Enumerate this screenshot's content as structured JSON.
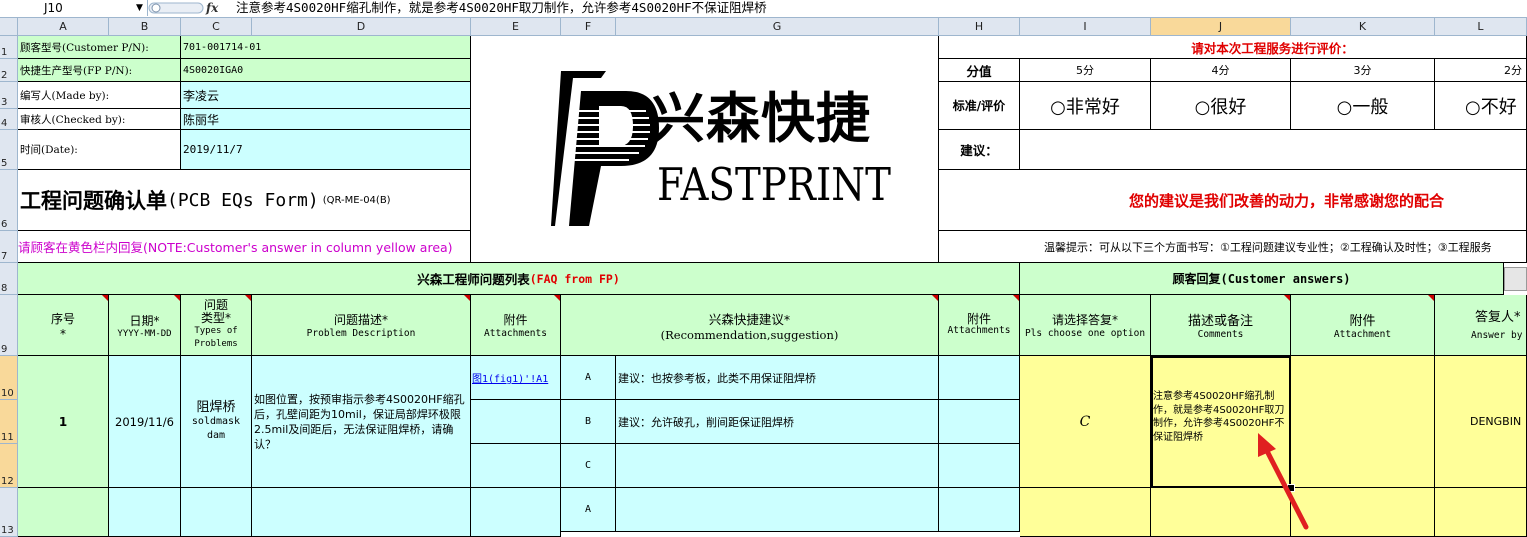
{
  "formula_bar": {
    "name_box": "J10",
    "fx": "fx",
    "content": "注意参考4S0020HF缩孔制作，就是参考4S0020HF取刀制作，允许参考4S0020HF不保证阻焊桥"
  },
  "columns": [
    "A",
    "B",
    "C",
    "D",
    "E",
    "F",
    "G",
    "H",
    "I",
    "J",
    "K",
    "L"
  ],
  "rows": [
    "1",
    "2",
    "3",
    "4",
    "5",
    "6",
    "7",
    "8",
    "9",
    "10",
    "11",
    "12",
    "13"
  ],
  "header_info": {
    "customer_pn_label": "顾客型号(Customer P/N):",
    "customer_pn": "701-001714-01",
    "fp_pn_label": "快捷生产型号(FP P/N):",
    "fp_pn": "4S0020IGA0",
    "made_by_label": "编写人(Made by):",
    "made_by": "李凌云",
    "checked_by_label": "审核人(Checked by):",
    "checked_by": "陈丽华",
    "date_label": "时间(Date):",
    "date": "2019/11/7",
    "form_title": "工程问题确认单",
    "form_title_en": "(PCB EQs Form)",
    "form_code": "(QR-ME-04(B)",
    "note": "请顾客在黄色栏内回复(NOTE:Customer's answer in column yellow area)"
  },
  "logo": {
    "cn": "兴森快捷",
    "en": "FASTPRINT"
  },
  "evaluation": {
    "title": "请对本次工程服务进行评价：",
    "score_label": "分值",
    "scores": [
      "5分",
      "4分",
      "3分",
      "2分"
    ],
    "criteria_label": "标准/评价",
    "options": [
      "○非常好",
      "○很好",
      "○一般",
      "○不好"
    ],
    "suggestion_label": "建议：",
    "thanks": "您的建议是我们改善的动力，非常感谢您的配合",
    "tip": "温馨提示：可从以下三个方面书写：①工程问题建议专业性；②工程确认及时性；③工程服务"
  },
  "sections": {
    "faq": "兴森工程师问题列表",
    "faq_en": "(FAQ from FP)",
    "customer": "顾客回复(Customer answers)"
  },
  "table_headers": {
    "no": "序号",
    "no_star": "*",
    "date": "日期*",
    "date_fmt": "YYYY-MM-DD",
    "type": "问题类型*",
    "type_en": "Types of Problems",
    "desc": "问题描述*",
    "desc_en": "Problem Description",
    "attach": "附件",
    "attach_en": "Attachments",
    "rec": "兴森快捷建议*",
    "rec_en": "(Recommendation,suggestion)",
    "attach2": "附件",
    "attach2_en": "Attachments",
    "choose": "请选择答复*",
    "choose_en": "Pls choose one option",
    "comments": "描述或备注",
    "comments_en": "Comments",
    "attach3": "附件",
    "attach3_en": "Attachment",
    "answer_by": "答复人*",
    "answer_by_en": "Answer by"
  },
  "item": {
    "no": "1",
    "date": "2019/11/6",
    "type": "阻焊桥",
    "type_en": "soldmask dam",
    "desc": "如图位置，按预审指示参考4S0020HF缩孔后，孔壁间距为10mil，保证局部焊环极限2.5mil及间距后，无法保证阻焊桥，请确认？",
    "attach_link": "图1(fig1)'!A1",
    "options": [
      "A",
      "B",
      "C"
    ],
    "option_texts": [
      "建议：也按参考板，此类不用保证阻焊桥",
      "建议：允许破孔，削间距保证阻焊桥",
      ""
    ],
    "choice": "C",
    "comment": "注意参考4S0020HF缩孔制作，就是参考4S0020HF取刀制作，允许参考4S0020HF不保证阻焊桥",
    "answer_by": "DENGBIN"
  },
  "next_item": {
    "options": [
      "A"
    ]
  }
}
